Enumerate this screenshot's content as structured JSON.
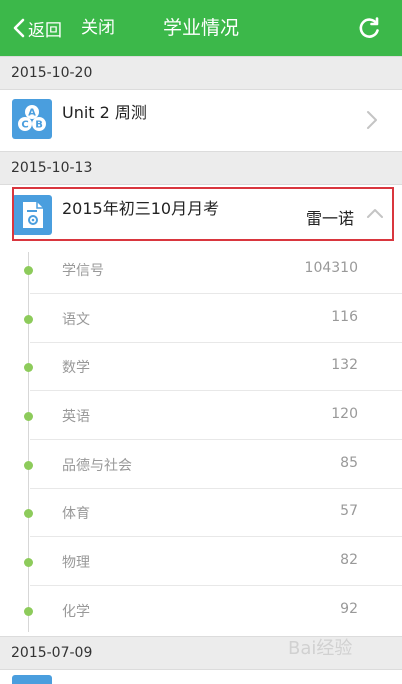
{
  "navbar": {
    "back_label": "返回",
    "close_label": "关闭",
    "title": "学业情况",
    "background": "#3cb84a"
  },
  "sections": [
    {
      "date": "2015-10-20"
    },
    {
      "date": "2015-10-13"
    },
    {
      "date": "2015-07-09"
    }
  ],
  "reports": [
    {
      "title": "Unit 2 周测",
      "icon": "abc-quiz-icon"
    },
    {
      "title": "2015年初三10月月考",
      "student": "雷一诺",
      "icon": "exam-document-icon",
      "expanded": true
    }
  ],
  "details": [
    {
      "label": "学信号",
      "value": "104310"
    },
    {
      "label": "语文",
      "value": "116"
    },
    {
      "label": "数学",
      "value": "132"
    },
    {
      "label": "英语",
      "value": "120"
    },
    {
      "label": "品德与社会",
      "value": "85"
    },
    {
      "label": "体育",
      "value": "57"
    },
    {
      "label": "物理",
      "value": "82"
    },
    {
      "label": "化学",
      "value": "92"
    }
  ],
  "watermark": {
    "text": "Bai经验"
  },
  "colors": {
    "accent": "#3cb84a",
    "highlight_border": "#d9363e",
    "timeline_dot": "#8dcb5b",
    "icon_blue": "#4a9ede"
  }
}
